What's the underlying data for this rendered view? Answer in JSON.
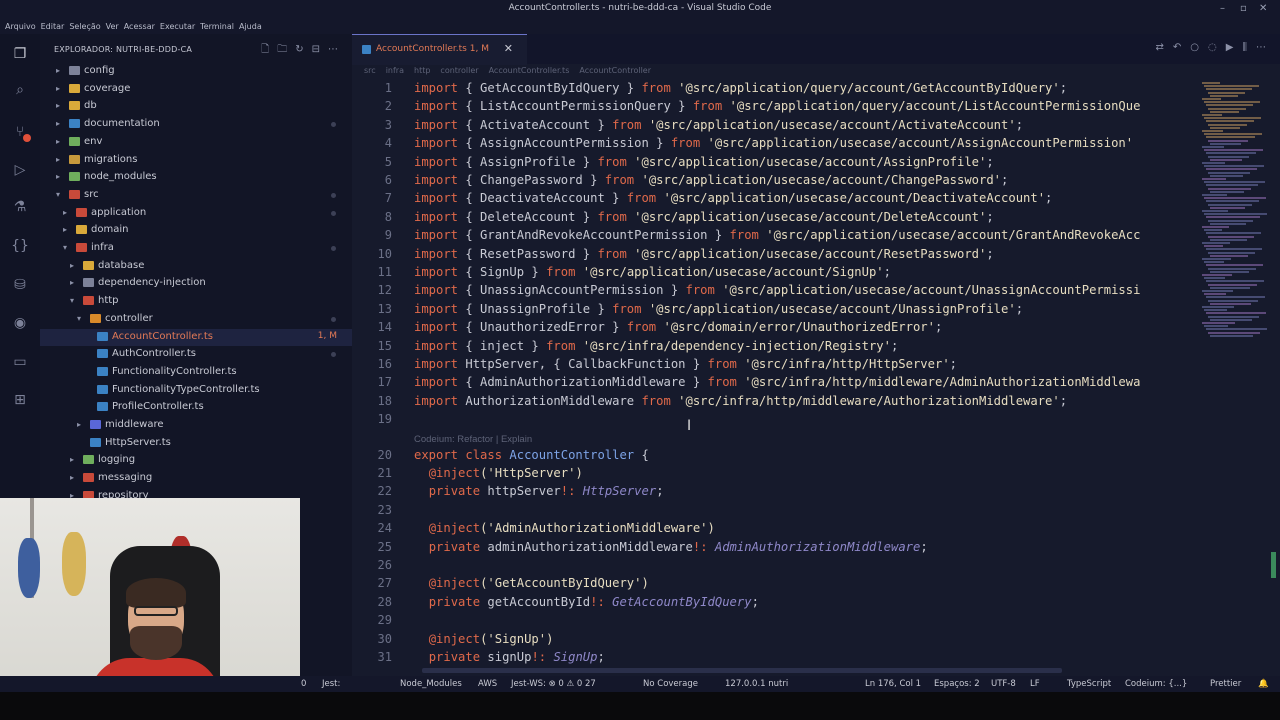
{
  "window": {
    "title": "AccountController.ts - nutri-be-ddd-ca - Visual Studio Code"
  },
  "menu": [
    "Arquivo",
    "Editar",
    "Seleção",
    "Ver",
    "Acessar",
    "Executar",
    "Terminal",
    "Ajuda"
  ],
  "activity_icons": [
    "files-icon",
    "search-icon",
    "source-control-icon",
    "run-debug-icon",
    "testing-icon",
    "extensions-json-icon",
    "database-icon",
    "remote-icon",
    "folder-icon",
    "extensions-icon"
  ],
  "sidebar": {
    "title": "EXPLORADOR: NUTRI-BE-DDD-CA",
    "items": [
      {
        "label": "config",
        "type": "folder-closed"
      },
      {
        "label": "coverage",
        "type": "folder-closed"
      },
      {
        "label": "db",
        "type": "folder-closed"
      },
      {
        "label": "documentation",
        "type": "folder-closed"
      },
      {
        "label": "env",
        "type": "folder-closed"
      },
      {
        "label": "migrations",
        "type": "folder-closed"
      },
      {
        "label": "node_modules",
        "type": "folder-closed"
      },
      {
        "label": "src",
        "type": "folder-open"
      },
      {
        "label": "application",
        "type": "folder-closed"
      },
      {
        "label": "domain",
        "type": "folder-closed"
      },
      {
        "label": "infra",
        "type": "folder-open"
      },
      {
        "label": "database",
        "type": "folder-closed"
      },
      {
        "label": "dependency-injection",
        "type": "folder-closed"
      },
      {
        "label": "http",
        "type": "folder-open"
      },
      {
        "label": "controller",
        "type": "folder-open"
      },
      {
        "label": "AccountController.ts",
        "type": "file",
        "meta": "1, M"
      },
      {
        "label": "AuthController.ts",
        "type": "file"
      },
      {
        "label": "FunctionalityController.ts",
        "type": "file"
      },
      {
        "label": "FunctionalityTypeController.ts",
        "type": "file"
      },
      {
        "label": "ProfileController.ts",
        "type": "file"
      },
      {
        "label": "middleware",
        "type": "folder-closed"
      },
      {
        "label": "HttpServer.ts",
        "type": "file"
      },
      {
        "label": "logging",
        "type": "folder-closed"
      },
      {
        "label": "messaging",
        "type": "folder-closed"
      },
      {
        "label": "repository",
        "type": "folder-closed"
      }
    ]
  },
  "tab": {
    "label": "AccountController.ts",
    "meta": "1, M"
  },
  "breadcrumb": [
    "src",
    "infra",
    "http",
    "controller",
    "AccountController.ts",
    "AccountController"
  ],
  "code": {
    "lines": [
      {
        "n": "1",
        "parts": [
          [
            "kw",
            "import"
          ],
          [
            "",
            "{ GetAccountByIdQuery } "
          ],
          [
            "kw",
            "from"
          ],
          [
            "str",
            " '@src/application/query/account/GetAccountByIdQuery'"
          ],
          [
            "",
            ";"
          ]
        ]
      },
      {
        "n": "2",
        "parts": [
          [
            "kw",
            "import"
          ],
          [
            "",
            "{ ListAccountPermissionQuery } "
          ],
          [
            "kw",
            "from"
          ],
          [
            "str",
            " '@src/application/query/account/ListAccountPermissionQue"
          ]
        ]
      },
      {
        "n": "3",
        "parts": [
          [
            "kw",
            "import"
          ],
          [
            "",
            "{ ActivateAccount } "
          ],
          [
            "kw",
            "from"
          ],
          [
            "str",
            " '@src/application/usecase/account/ActivateAccount'"
          ],
          [
            "",
            ";"
          ]
        ]
      },
      {
        "n": "4",
        "parts": [
          [
            "kw",
            "import"
          ],
          [
            "",
            "{ AssignAccountPermission } "
          ],
          [
            "kw",
            "from"
          ],
          [
            "str",
            " '@src/application/usecase/account/AssignAccountPermission'"
          ]
        ]
      },
      {
        "n": "5",
        "parts": [
          [
            "kw",
            "import"
          ],
          [
            "",
            "{ AssignProfile } "
          ],
          [
            "kw",
            "from"
          ],
          [
            "str",
            " '@src/application/usecase/account/AssignProfile'"
          ],
          [
            "",
            ";"
          ]
        ]
      },
      {
        "n": "6",
        "parts": [
          [
            "kw",
            "import"
          ],
          [
            "",
            "{ ChangePassword } "
          ],
          [
            "kw",
            "from"
          ],
          [
            "str",
            " '@src/application/usecase/account/ChangePassword'"
          ],
          [
            "",
            ";"
          ]
        ]
      },
      {
        "n": "7",
        "parts": [
          [
            "kw",
            "import"
          ],
          [
            "",
            "{ DeactivateAccount } "
          ],
          [
            "kw",
            "from"
          ],
          [
            "str",
            " '@src/application/usecase/account/DeactivateAccount'"
          ],
          [
            "",
            ";"
          ]
        ]
      },
      {
        "n": "8",
        "parts": [
          [
            "kw",
            "import"
          ],
          [
            "",
            "{ DeleteAccount } "
          ],
          [
            "kw",
            "from"
          ],
          [
            "str",
            " '@src/application/usecase/account/DeleteAccount'"
          ],
          [
            "",
            ";"
          ]
        ]
      },
      {
        "n": "9",
        "parts": [
          [
            "kw",
            "import"
          ],
          [
            "",
            "{ GrantAndRevokeAccountPermission } "
          ],
          [
            "kw",
            "from"
          ],
          [
            "str",
            " '@src/application/usecase/account/GrantAndRevokeAcc"
          ]
        ]
      },
      {
        "n": "10",
        "parts": [
          [
            "kw",
            "import"
          ],
          [
            "",
            "{ ResetPassword } "
          ],
          [
            "kw",
            "from"
          ],
          [
            "str",
            " '@src/application/usecase/account/ResetPassword'"
          ],
          [
            "",
            ";"
          ]
        ]
      },
      {
        "n": "11",
        "parts": [
          [
            "kw",
            "import"
          ],
          [
            "",
            "{ SignUp } "
          ],
          [
            "kw",
            "from"
          ],
          [
            "str",
            " '@src/application/usecase/account/SignUp'"
          ],
          [
            "",
            ";"
          ]
        ]
      },
      {
        "n": "12",
        "parts": [
          [
            "kw",
            "import"
          ],
          [
            "",
            "{ UnassignAccountPermission } "
          ],
          [
            "kw",
            "from"
          ],
          [
            "str",
            " '@src/application/usecase/account/UnassignAccountPermissi"
          ]
        ]
      },
      {
        "n": "13",
        "parts": [
          [
            "kw",
            "import"
          ],
          [
            "",
            "{ UnassignProfile } "
          ],
          [
            "kw",
            "from"
          ],
          [
            "str",
            " '@src/application/usecase/account/UnassignProfile'"
          ],
          [
            "",
            ";"
          ]
        ]
      },
      {
        "n": "14",
        "parts": [
          [
            "kw",
            "import"
          ],
          [
            "",
            "{ UnauthorizedError } "
          ],
          [
            "kw",
            "from"
          ],
          [
            "str",
            " '@src/domain/error/UnauthorizedError'"
          ],
          [
            "",
            ";"
          ]
        ]
      },
      {
        "n": "15",
        "parts": [
          [
            "kw",
            "import"
          ],
          [
            "",
            "{ inject } "
          ],
          [
            "kw",
            "from"
          ],
          [
            "str",
            " '@src/infra/dependency-injection/Registry'"
          ],
          [
            "",
            ";"
          ]
        ]
      },
      {
        "n": "16",
        "parts": [
          [
            "kw",
            "import"
          ],
          [
            "",
            "HttpServer, { CallbackFunction } "
          ],
          [
            "kw",
            "from"
          ],
          [
            "str",
            " '@src/infra/http/HttpServer'"
          ],
          [
            "",
            ";"
          ]
        ]
      },
      {
        "n": "17",
        "parts": [
          [
            "kw",
            "import"
          ],
          [
            "",
            "{ AdminAuthorizationMiddleware } "
          ],
          [
            "kw",
            "from"
          ],
          [
            "str",
            " '@src/infra/http/middleware/AdminAuthorizationMiddlewa"
          ]
        ]
      },
      {
        "n": "18",
        "parts": [
          [
            "kw",
            "import"
          ],
          [
            "",
            "AuthorizationMiddleware "
          ],
          [
            "kw",
            "from"
          ],
          [
            "str",
            " '@src/infra/http/middleware/AuthorizationMiddleware'"
          ],
          [
            "",
            ";"
          ]
        ]
      },
      {
        "n": "19",
        "parts": []
      },
      {
        "n": "20",
        "parts": [
          [
            "kw",
            "export class"
          ],
          [
            "cls",
            " AccountController"
          ],
          [
            "",
            " {"
          ]
        ]
      },
      {
        "n": "21",
        "parts": [
          [
            "",
            "  "
          ],
          [
            "dec",
            "@inject"
          ],
          [
            "str",
            "('HttpServer')"
          ]
        ]
      },
      {
        "n": "22",
        "parts": [
          [
            "",
            "  "
          ],
          [
            "kw",
            "private"
          ],
          [
            "",
            " httpServer"
          ],
          [
            "kw",
            "!:"
          ],
          [
            "typ",
            " HttpServer"
          ],
          [
            "",
            ";"
          ]
        ]
      },
      {
        "n": "23",
        "parts": []
      },
      {
        "n": "24",
        "parts": [
          [
            "",
            "  "
          ],
          [
            "dec",
            "@inject"
          ],
          [
            "str",
            "('AdminAuthorizationMiddleware')"
          ]
        ]
      },
      {
        "n": "25",
        "parts": [
          [
            "",
            "  "
          ],
          [
            "kw",
            "private"
          ],
          [
            "",
            " adminAuthorizationMiddleware"
          ],
          [
            "kw",
            "!:"
          ],
          [
            "typ",
            " AdminAuthorizationMiddleware"
          ],
          [
            "",
            ";"
          ]
        ]
      },
      {
        "n": "26",
        "parts": []
      },
      {
        "n": "27",
        "parts": [
          [
            "",
            "  "
          ],
          [
            "dec",
            "@inject"
          ],
          [
            "str",
            "('GetAccountByIdQuery')"
          ]
        ]
      },
      {
        "n": "28",
        "parts": [
          [
            "",
            "  "
          ],
          [
            "kw",
            "private"
          ],
          [
            "",
            " getAccountById"
          ],
          [
            "kw",
            "!:"
          ],
          [
            "typ",
            " GetAccountByIdQuery"
          ],
          [
            "",
            ";"
          ]
        ]
      },
      {
        "n": "29",
        "parts": []
      },
      {
        "n": "30",
        "parts": [
          [
            "",
            "  "
          ],
          [
            "dec",
            "@inject"
          ],
          [
            "str",
            "('SignUp')"
          ]
        ]
      },
      {
        "n": "31",
        "parts": [
          [
            "",
            "  "
          ],
          [
            "kw",
            "private"
          ],
          [
            "",
            " signUp"
          ],
          [
            "kw",
            "!:"
          ],
          [
            "typ",
            " SignUp"
          ],
          [
            "",
            ";"
          ]
        ]
      }
    ],
    "codelens": "Codeium: Refactor | Explain"
  },
  "statusbar": {
    "jest": "Jest:",
    "node_modules": "Node_Modules",
    "aws": "AWS",
    "jest_ws": "Jest-WS: ⊗ 0 ⚠ 0 27",
    "coverage": "No Coverage",
    "server": "127.0.0.1 nutri",
    "position": "Ln 176, Col 1",
    "spaces": "Espaços: 2",
    "encoding": "UTF-8",
    "eol": "LF",
    "language": "TypeScript",
    "codeium": "Codeium: {...}",
    "prettier": "Prettier",
    "errors_left": "0"
  }
}
